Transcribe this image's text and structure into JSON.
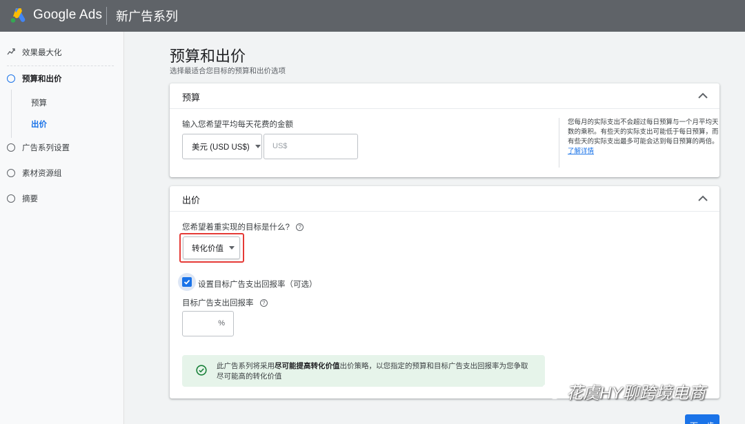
{
  "topbar": {
    "brand": "Google Ads",
    "campaign_title": "新广告系列"
  },
  "sidebar": {
    "items": [
      {
        "label": "效果最大化",
        "icon": "trend-icon"
      },
      {
        "label": "预算和出价",
        "icon": "circle-icon",
        "active": true
      },
      {
        "label": "广告系列设置",
        "icon": "circle-icon"
      },
      {
        "label": "素材资源组",
        "icon": "circle-icon"
      },
      {
        "label": "摘要",
        "icon": "circle-icon"
      }
    ],
    "sub_items": [
      {
        "label": "预算"
      },
      {
        "label": "出价",
        "active": true
      }
    ]
  },
  "page": {
    "title": "预算和出价",
    "subtitle": "选择最适合您目标的预算和出价选项"
  },
  "budget_card": {
    "title": "预算",
    "field_label": "输入您希望平均每天花费的金额",
    "currency_select": "美元 (USD US$)",
    "amount_placeholder": "US$",
    "help_text": "您每月的实际支出不会超过每日预算与一个月平均天数的乘积。有些天的实际支出可能低于每日预算，而有些天的实际支出最多可能会达到每日预算的两倍。",
    "help_link": "了解详情"
  },
  "bidding_card": {
    "title": "出价",
    "goal_question": "您希望着重实现的目标是什么?",
    "goal_select": "转化价值",
    "roas_checkbox_label": "设置目标广告支出回报率（可选）",
    "roas_checked": true,
    "roas_field_label": "目标广告支出回报率",
    "roas_unit": "%",
    "banner_prefix": "此广告系列将采用",
    "banner_bold": "尽可能提高转化价值",
    "banner_suffix": "出价策略，以您指定的预算和目标广告支出回报率为您争取尽可能高的转化价值"
  },
  "actions": {
    "next_label": "下一步"
  },
  "watermark": {
    "text": "花虞HY聊跨境电商"
  },
  "colors": {
    "topbar": "#5f6368",
    "accent": "#1a73e8",
    "highlight": "#e53935",
    "banner_bg": "#e6f4ea",
    "success": "#188038"
  }
}
